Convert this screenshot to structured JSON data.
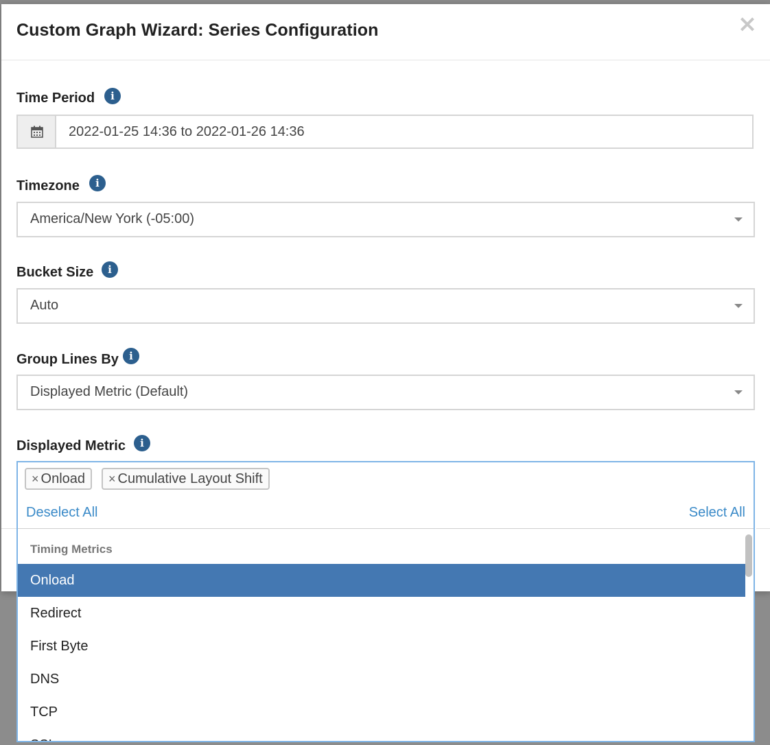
{
  "modal": {
    "title": "Custom Graph Wizard: Series Configuration",
    "close_glyph": "×"
  },
  "time_period": {
    "label": "Time Period",
    "value": "2022-01-25 14:36 to 2022-01-26 14:36",
    "icon": "calendar-icon"
  },
  "timezone": {
    "label": "Timezone",
    "value": "America/New York (-05:00)"
  },
  "bucket_size": {
    "label": "Bucket Size",
    "value": "Auto"
  },
  "group_lines_by": {
    "label": "Group Lines By",
    "value": "Displayed Metric (Default)"
  },
  "displayed_metric": {
    "label": "Displayed Metric",
    "selected_tags": [
      "Onload",
      "Cumulative Layout Shift"
    ],
    "tag_remove_glyph": "×",
    "deselect_all": "Deselect All",
    "select_all": "Select All",
    "group_header": "Timing Metrics",
    "options": [
      "Onload",
      "Redirect",
      "First Byte",
      "DNS",
      "TCP",
      "SSL"
    ],
    "highlighted_option": "Onload"
  },
  "info_glyph": "i",
  "colors": {
    "accent": "#4478b2",
    "info_icon": "#2c5f8e",
    "link": "#3a8ac8",
    "focus_border": "#7eb4e6"
  }
}
